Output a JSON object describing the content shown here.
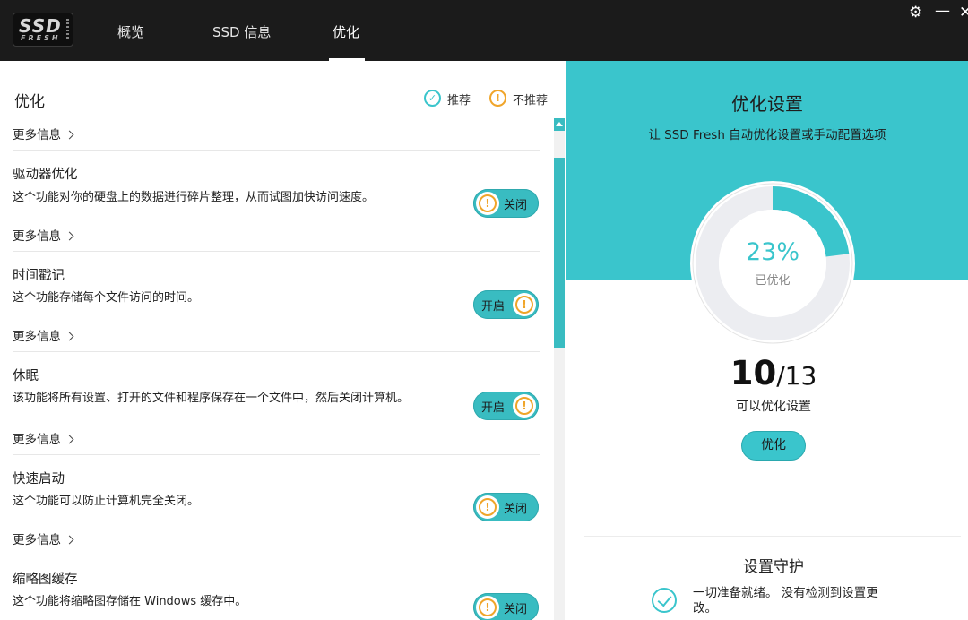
{
  "app": {
    "logo_main": "SSD",
    "logo_sub": "FRESH",
    "tabs": [
      {
        "label": "概览"
      },
      {
        "label": "SSD 信息"
      },
      {
        "label": "优化"
      }
    ],
    "window_controls": {
      "settings": "⚙",
      "minimize": "—",
      "close": "✕"
    }
  },
  "left": {
    "title": "优化",
    "legend_recommended": "推荐",
    "legend_not_recommended": "不推荐",
    "more_info": "更多信息",
    "items": [
      {
        "title": "驱动器优化",
        "desc": "这个功能对你的硬盘上的数据进行碎片整理，从而试图加快访问速度。",
        "state": "关闭"
      },
      {
        "title": "时间戳记",
        "desc": "这个功能存储每个文件访问的时间。",
        "state": "开启"
      },
      {
        "title": "休眠",
        "desc": "该功能将所有设置、打开的文件和程序保存在一个文件中，然后关闭计算机。",
        "state": "开启"
      },
      {
        "title": "快速启动",
        "desc": "这个功能可以防止计算机完全关闭。",
        "state": "关闭"
      },
      {
        "title": "缩略图缓存",
        "desc": "这个功能将缩略图存储在 Windows 缓存中。",
        "state": "关闭"
      }
    ]
  },
  "right": {
    "title": "优化设置",
    "subtitle": "让 SSD Fresh 自动优化设置或手动配置选项",
    "percent": "23%",
    "percent_value": 23,
    "percent_label": "已优化",
    "count_done": "10",
    "count_total": "/13",
    "count_label": "可以优化设置",
    "optimize_button": "优化",
    "guard_title": "设置守护",
    "guard_text": "一切准备就绪。 没有检测到设置更改。"
  },
  "colors": {
    "accent": "#3ac5cc",
    "warning": "#f0a52a",
    "topbar": "#1b1b1b"
  }
}
